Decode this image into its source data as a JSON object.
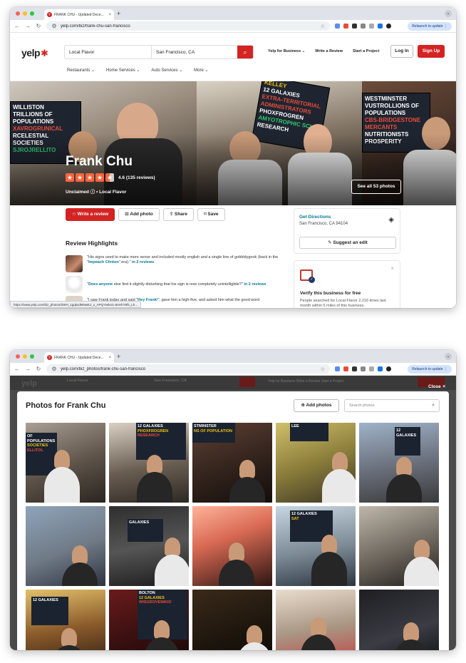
{
  "browser": {
    "tab_title": "FRANK CHU - Updated Dece...",
    "favicon_letter": "y",
    "tab_close": "×",
    "new_tab": "+",
    "tab_menu": "⌄",
    "url_business": "yelp.com/biz/frank-chu-san-francisco",
    "url_photos": "yelp.com/biz_photos/frank-chu-san-francisco",
    "relaunch": "Relaunch to update ⋮",
    "star": "☆"
  },
  "yelp": {
    "logo": "yelp",
    "search_find": "Local Flavor",
    "search_near": "San Francisco, CA",
    "search_icon": "⌕",
    "header_links": [
      "Yelp for Business ⌄",
      "Write a Review",
      "Start a Project"
    ],
    "login": "Log In",
    "signup": "Sign Up",
    "categories": [
      "Restaurants ⌄",
      "Home Services ⌄",
      "Auto Services ⌄",
      "More ⌄"
    ]
  },
  "business": {
    "name": "Frank Chu",
    "rating": 4.6,
    "rating_text": "4.6 (135 reviews)",
    "meta": "Unclaimed ⓘ  •  Local Flavor",
    "see_photos": "See all 53 photos",
    "actions": [
      "☆ Write a review",
      "⊡ Add photo",
      "⇪ Share",
      "⌑ Save"
    ],
    "get_directions": "Get Directions",
    "address": "San Francisco, CA 94104",
    "directions_icon": "◈",
    "suggest_edit": "✎ Suggest an edit",
    "review_highlights": "Review Highlights",
    "reviews": [
      {
        "pre": "\"His signs used to make more sense and included mostly english and a single line of gobbldygook (back in the \"",
        "link": "Impeach Clinton",
        "post": "\" era).\" ",
        "more": "in 2 reviews"
      },
      {
        "pre": "\"",
        "link": "Does anyone",
        "post": " else find it slightly disturbing that his sign is now completely unintelligible?\" ",
        "more": "in 2 reviews"
      },
      {
        "pre": "\"I saw Frank today and said \"",
        "link": "Hey Frank!",
        "post": "\", gave him a high-five, and asked him what the good word",
        "more": ""
      }
    ],
    "verify_title": "Verify this business for free",
    "verify_text": "People searched for Local Flavor 2,216 times last month within 5 miles of this business.",
    "verify_close": "×",
    "status_url": "https://www.yelp.com/biz_photos/ZWH_1gqkxdMNwEJ_x_APQ?select=9nHhY9fs_Lh..."
  },
  "hero_signs": [
    {
      "lines": [
        "WILLISTON",
        "TRILLIONS OF POPULATIONS",
        "XAVROGRUNICAL",
        "RCELESTIAL SOCIETIES",
        "SJROJRELLITO"
      ],
      "colors": [
        "#ffffff",
        "#ffffff",
        "#e74c3c",
        "#ffffff",
        "#2ecc71"
      ]
    },
    {
      "lines": [
        "KELLEY",
        "12 GALAXIES",
        "EXTRA-TERRITORIAL ADMINISTRATORS",
        "PHOXFROGREN",
        "AMYOTROPHIC SCL",
        "RESEARCH"
      ],
      "colors": [
        "#f1c40f",
        "#ffffff",
        "#e74c3c",
        "#ffffff",
        "#2ecc71",
        "#ffffff"
      ]
    },
    {
      "lines": [
        "WESTMINSTER",
        "VUSTROLLIONS OF POPULATIONS",
        "CBS-BRIDGESTONE MERCANTS",
        "NUTRITIONISTS PROSPERITY"
      ],
      "colors": [
        "#ffffff",
        "#ffffff",
        "#e74c3c",
        "#ffffff"
      ]
    }
  ],
  "photos_modal": {
    "close": "Close ✕",
    "title": "Photos for Frank Chu",
    "add_photos": "⊕ Add photos",
    "search_placeholder": "Search photos",
    "search_icon": "⌕",
    "photo_signs": [
      [
        "OF POPULATIONS",
        "SOCIETIES",
        "ELLITOL"
      ],
      [
        "12 GALAXIES",
        "PHOXFROGREN",
        "RESEARCH"
      ],
      [
        "STMINSTER",
        "NS OF POPULATION"
      ],
      [
        "LEE"
      ],
      [
        "12 GALAXIES"
      ],
      [],
      [
        "GALAXIES"
      ],
      [],
      [
        "12 GALAXIES",
        "SAT"
      ],
      [],
      [
        "12 GALAXIES"
      ],
      [
        "BOLTON",
        "12 GALAXIES",
        "WISGROVENIKIO"
      ],
      [],
      [],
      []
    ]
  },
  "dimmed_header": {
    "logo": "yelp",
    "find": "Local Flavor",
    "near": "San Francisco, CA",
    "links": "Yelp for Business   Write a Review   Start a Project"
  }
}
